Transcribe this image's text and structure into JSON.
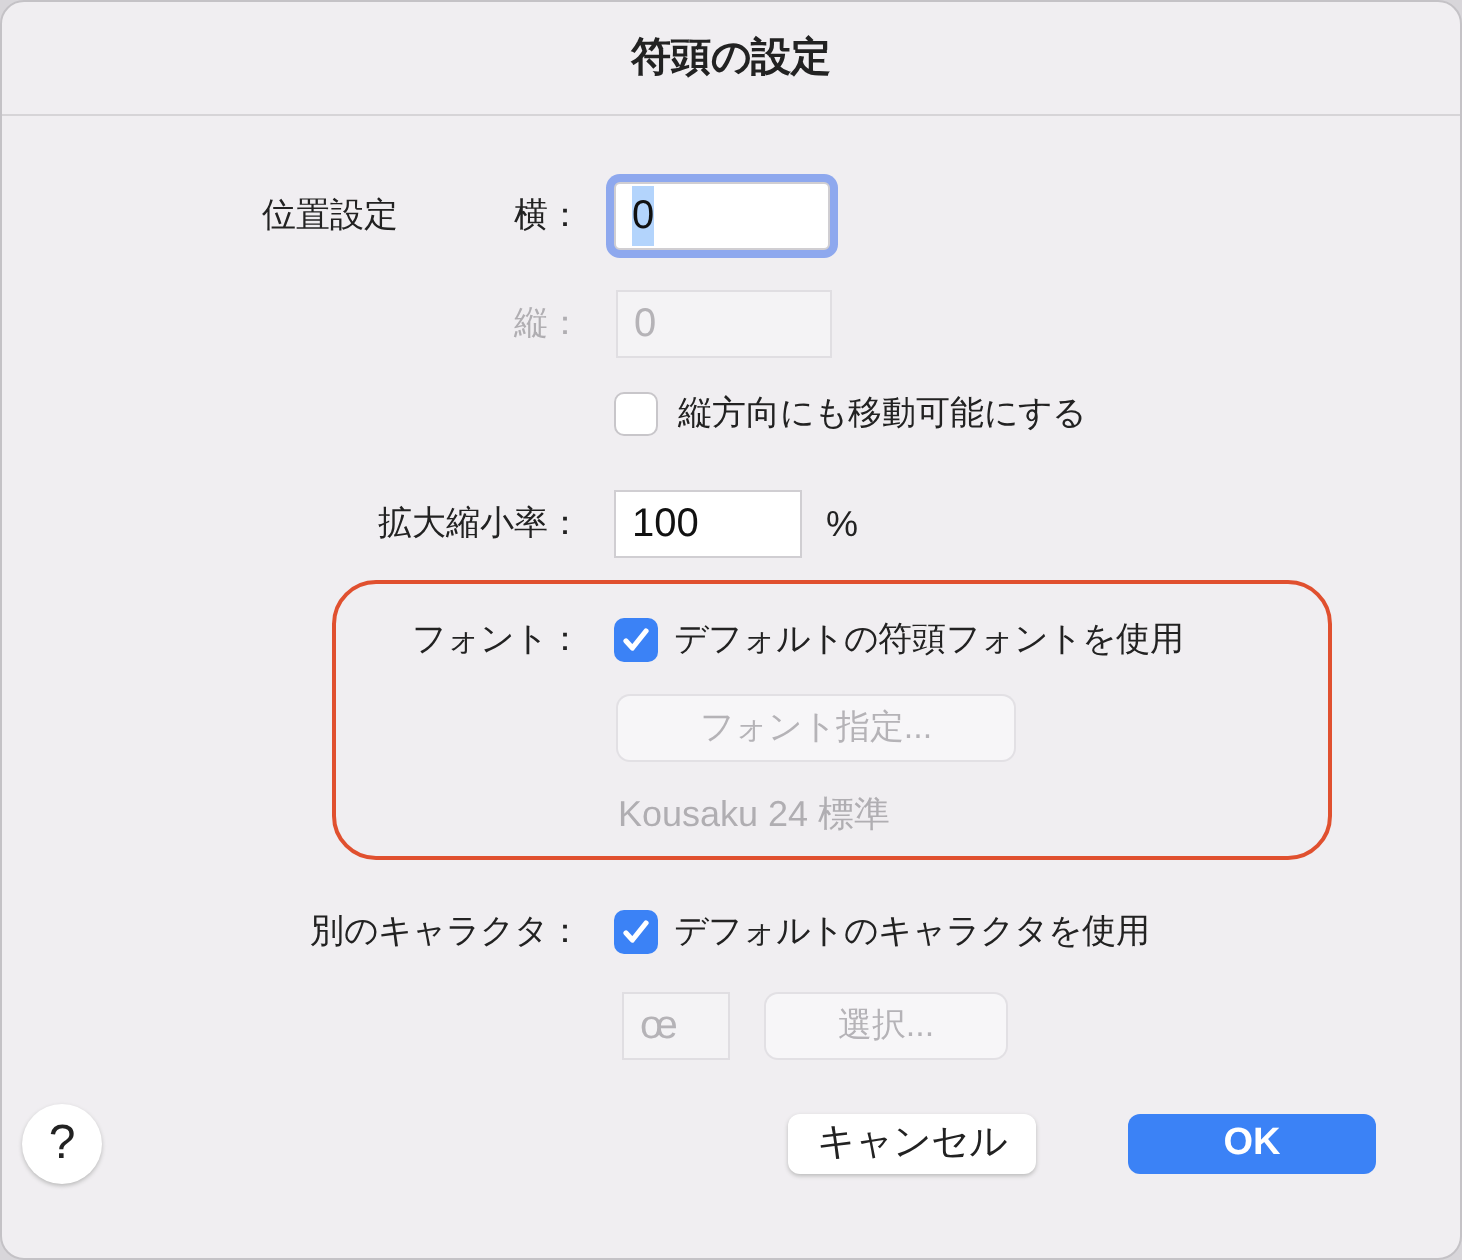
{
  "window": {
    "title": "符頭の設定"
  },
  "position": {
    "label": "位置設定",
    "horizontal": {
      "label": "横：",
      "value": "0",
      "focused": true,
      "disabled": false
    },
    "vertical": {
      "label": "縦：",
      "value": "0",
      "focused": false,
      "disabled": true
    },
    "allow_vertical": {
      "label": "縦方向にも移動可能にする",
      "checked": false
    }
  },
  "scale": {
    "label": "拡大縮小率：",
    "value": "100",
    "unit": "%"
  },
  "font": {
    "highlighted": true,
    "label": "フォント：",
    "use_default": {
      "label": "デフォルトの符頭フォントを使用",
      "checked": true
    },
    "button": {
      "label": "フォント指定...",
      "disabled": true
    },
    "current": "Kousaku 24 標準"
  },
  "alt_char": {
    "label": "別のキャラクタ：",
    "use_default": {
      "label": "デフォルトのキャラクタを使用",
      "checked": true
    },
    "char": "œ",
    "button": {
      "label": "選択...",
      "disabled": true
    }
  },
  "help": "?",
  "buttons": [
    {
      "label": "キャンセル",
      "primary": false
    },
    {
      "label": "OK",
      "primary": true
    }
  ]
}
